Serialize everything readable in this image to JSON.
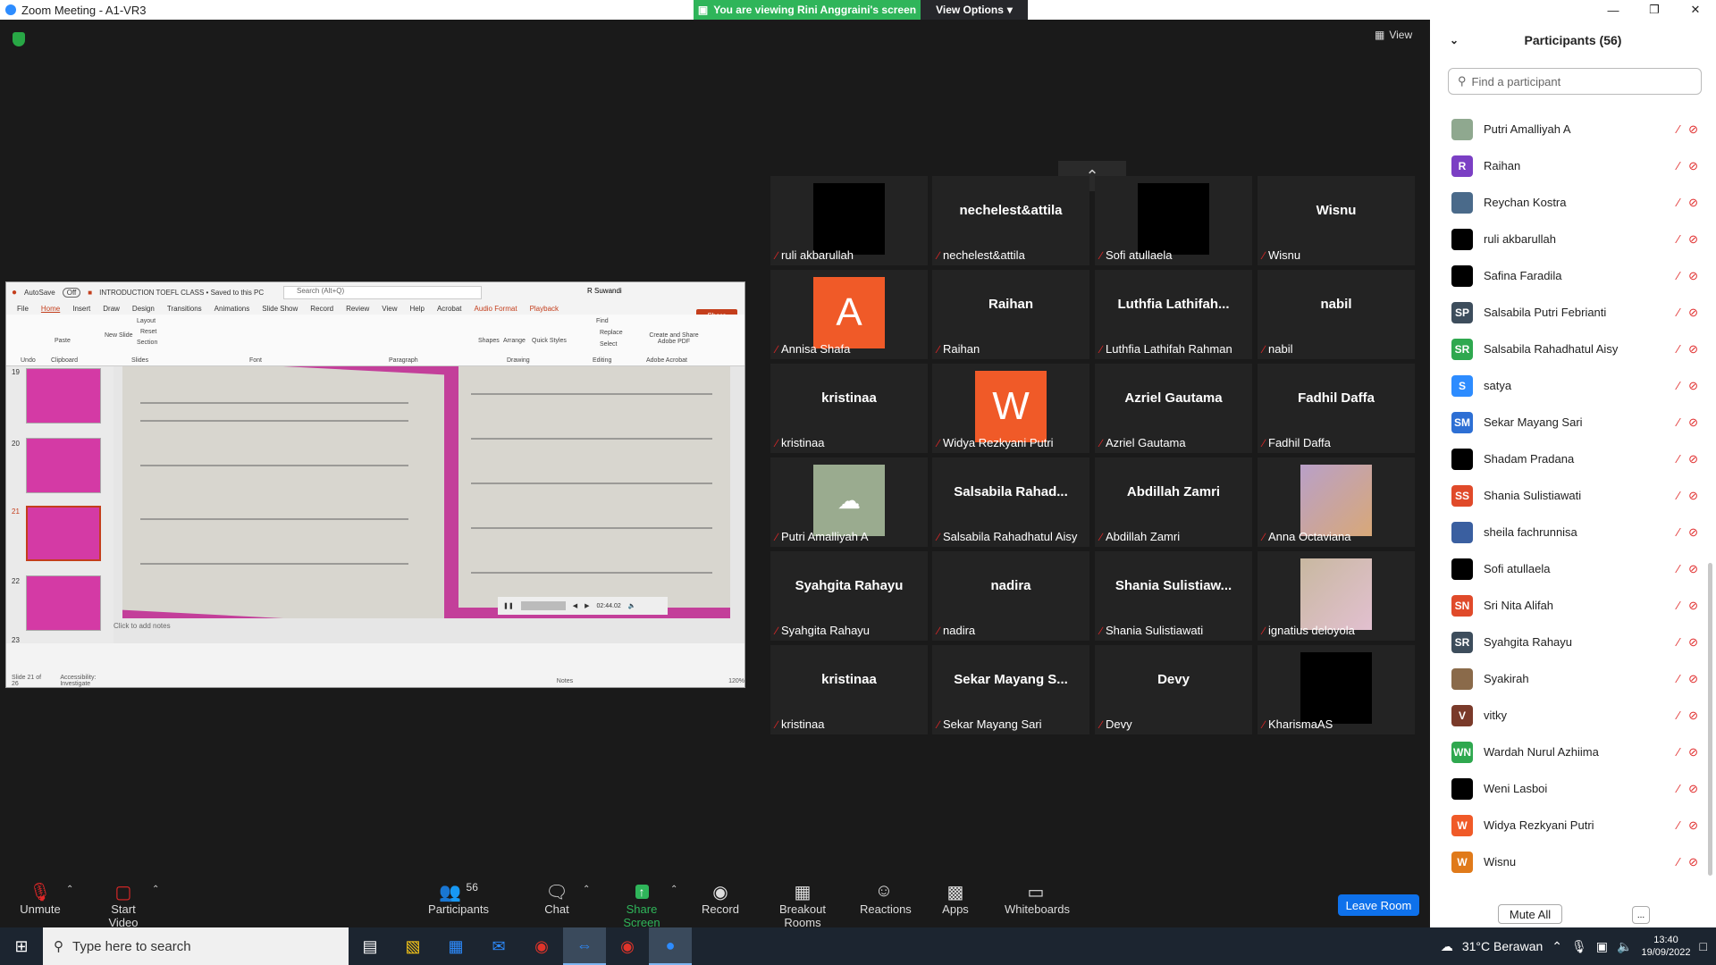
{
  "window": {
    "title": "Zoom Meeting - A1-VR3",
    "viewing_banner": "You are viewing Rini Anggraini's screen",
    "view_options": "View Options",
    "view_label": "View"
  },
  "ppt": {
    "autosave": "AutoSave",
    "autosave_state": "Off",
    "doc_title": "INTRODUCTION TOEFL CLASS • Saved to this PC",
    "search_placeholder": "Search (Alt+Q)",
    "user": "R Suwandi",
    "menu": [
      "File",
      "Home",
      "Insert",
      "Draw",
      "Design",
      "Transitions",
      "Animations",
      "Slide Show",
      "Record",
      "Review",
      "View",
      "Help",
      "Acrobat",
      "Audio Format",
      "Playback"
    ],
    "share": "Share",
    "ribbon_groups": [
      "Undo",
      "Clipboard",
      "Slides",
      "Font",
      "Paragraph",
      "Drawing",
      "Editing",
      "Adobe Acrobat"
    ],
    "ribbon_buttons": [
      "Paste",
      "New Slide",
      "Layout",
      "Reset",
      "Section",
      "Shapes",
      "Arrange",
      "Quick Styles",
      "Find",
      "Replace",
      "Select",
      "Create and Share Adobe PDF"
    ],
    "slide_numbers": [
      "19",
      "20",
      "21",
      "22",
      "23"
    ],
    "notes_placeholder": "Click to add notes",
    "media_time": "02:44.02",
    "status_slide": "Slide 21 of 26",
    "status_accessibility": "Accessibility: Investigate",
    "status_notes": "Notes",
    "zoom": "120%"
  },
  "tiles": [
    {
      "name": "",
      "label": "ruli akbarullah",
      "pic": "black"
    },
    {
      "name": "nechelest&attila",
      "label": "nechelest&attila",
      "pic": ""
    },
    {
      "name": "",
      "label": "Sofi atullaela",
      "pic": "black"
    },
    {
      "name": "Wisnu",
      "label": "Wisnu",
      "pic": ""
    },
    {
      "name": "",
      "label": "Annisa Shafa",
      "pic": "A"
    },
    {
      "name": "Raihan",
      "label": "Raihan",
      "pic": ""
    },
    {
      "name": "Luthfia  Lathifah...",
      "label": "Luthfia Lathifah Rahman",
      "pic": ""
    },
    {
      "name": "nabil",
      "label": "nabil",
      "pic": ""
    },
    {
      "name": "kristinaa",
      "label": "kristinaa",
      "pic": ""
    },
    {
      "name": "",
      "label": "Widya Rezkyani Putri",
      "pic": "W"
    },
    {
      "name": "Azriel Gautama",
      "label": "Azriel Gautama",
      "pic": ""
    },
    {
      "name": "Fadhil Daffa",
      "label": "Fadhil Daffa",
      "pic": ""
    },
    {
      "name": "",
      "label": "Putri Amalliyah A",
      "pic": "cloud"
    },
    {
      "name": "Salsabila  Rahad...",
      "label": "Salsabila Rahadhatul Aisy",
      "pic": ""
    },
    {
      "name": "Abdillah Zamri",
      "label": "Abdillah Zamri",
      "pic": ""
    },
    {
      "name": "",
      "label": "Anna Octaviana",
      "pic": "photo"
    },
    {
      "name": "Syahgita Rahayu",
      "label": "Syahgita Rahayu",
      "pic": ""
    },
    {
      "name": "nadira",
      "label": "nadira",
      "pic": ""
    },
    {
      "name": "Shania  Sulistiaw...",
      "label": "Shania Sulistiawati",
      "pic": ""
    },
    {
      "name": "",
      "label": "ignatius deloyola",
      "pic": "photo2"
    },
    {
      "name": "kristinaa",
      "label": "kristinaa",
      "pic": ""
    },
    {
      "name": "Sekar  Mayang  S...",
      "label": "Sekar Mayang Sari",
      "pic": ""
    },
    {
      "name": "Devy",
      "label": "Devy",
      "pic": ""
    },
    {
      "name": "",
      "label": "KharismaAS",
      "pic": "black"
    }
  ],
  "toolbar": {
    "unmute": "Unmute",
    "start_video": "Start Video",
    "participants": "Participants",
    "participants_count": "56",
    "chat": "Chat",
    "share_screen": "Share Screen",
    "record": "Record",
    "breakout": "Breakout Rooms",
    "reactions": "Reactions",
    "apps": "Apps",
    "whiteboards": "Whiteboards",
    "leave": "Leave Room"
  },
  "panel": {
    "title": "Participants (56)",
    "search_placeholder": "Find a participant",
    "mute_all": "Mute All",
    "more": "...",
    "participants": [
      {
        "name": "Putri Amalliyah A",
        "initials": "",
        "color": "#8fa88f"
      },
      {
        "name": "Raihan",
        "initials": "R",
        "color": "#7b3fc4"
      },
      {
        "name": "Reychan Kostra",
        "initials": "",
        "color": "#4a6a8a"
      },
      {
        "name": "ruli akbarullah",
        "initials": "",
        "color": "#000000"
      },
      {
        "name": "Safina Faradila",
        "initials": "",
        "color": "#000000"
      },
      {
        "name": "Salsabila Putri Febrianti",
        "initials": "SP",
        "color": "#3d4d5c"
      },
      {
        "name": "Salsabila Rahadhatul Aisy",
        "initials": "SR",
        "color": "#2fa84f"
      },
      {
        "name": "satya",
        "initials": "S",
        "color": "#2d8cff"
      },
      {
        "name": "Sekar Mayang Sari",
        "initials": "SM",
        "color": "#2d6fd4"
      },
      {
        "name": "Shadam Pradana",
        "initials": "",
        "color": "#000000"
      },
      {
        "name": "Shania Sulistiawati",
        "initials": "SS",
        "color": "#e04a2a"
      },
      {
        "name": "sheila fachrunnisa",
        "initials": "",
        "color": "#3a5fa0"
      },
      {
        "name": "Sofi atullaela",
        "initials": "",
        "color": "#000000"
      },
      {
        "name": "Sri Nita Alifah",
        "initials": "SN",
        "color": "#e04a2a"
      },
      {
        "name": "Syahgita Rahayu",
        "initials": "SR",
        "color": "#3d4d5c"
      },
      {
        "name": "Syakirah",
        "initials": "",
        "color": "#8a6a4a"
      },
      {
        "name": "vitky",
        "initials": "V",
        "color": "#7a3a2a"
      },
      {
        "name": "Wardah Nurul Azhiima",
        "initials": "WN",
        "color": "#2fa84f"
      },
      {
        "name": "Weni Lasboi",
        "initials": "",
        "color": "#000000"
      },
      {
        "name": "Widya Rezkyani Putri",
        "initials": "W",
        "color": "#f05a28"
      },
      {
        "name": "Wisnu",
        "initials": "W",
        "color": "#e07a1a"
      }
    ]
  },
  "taskbar": {
    "search_placeholder": "Type here to search",
    "weather": "31°C  Berawan",
    "time": "13:40",
    "date": "19/09/2022"
  }
}
